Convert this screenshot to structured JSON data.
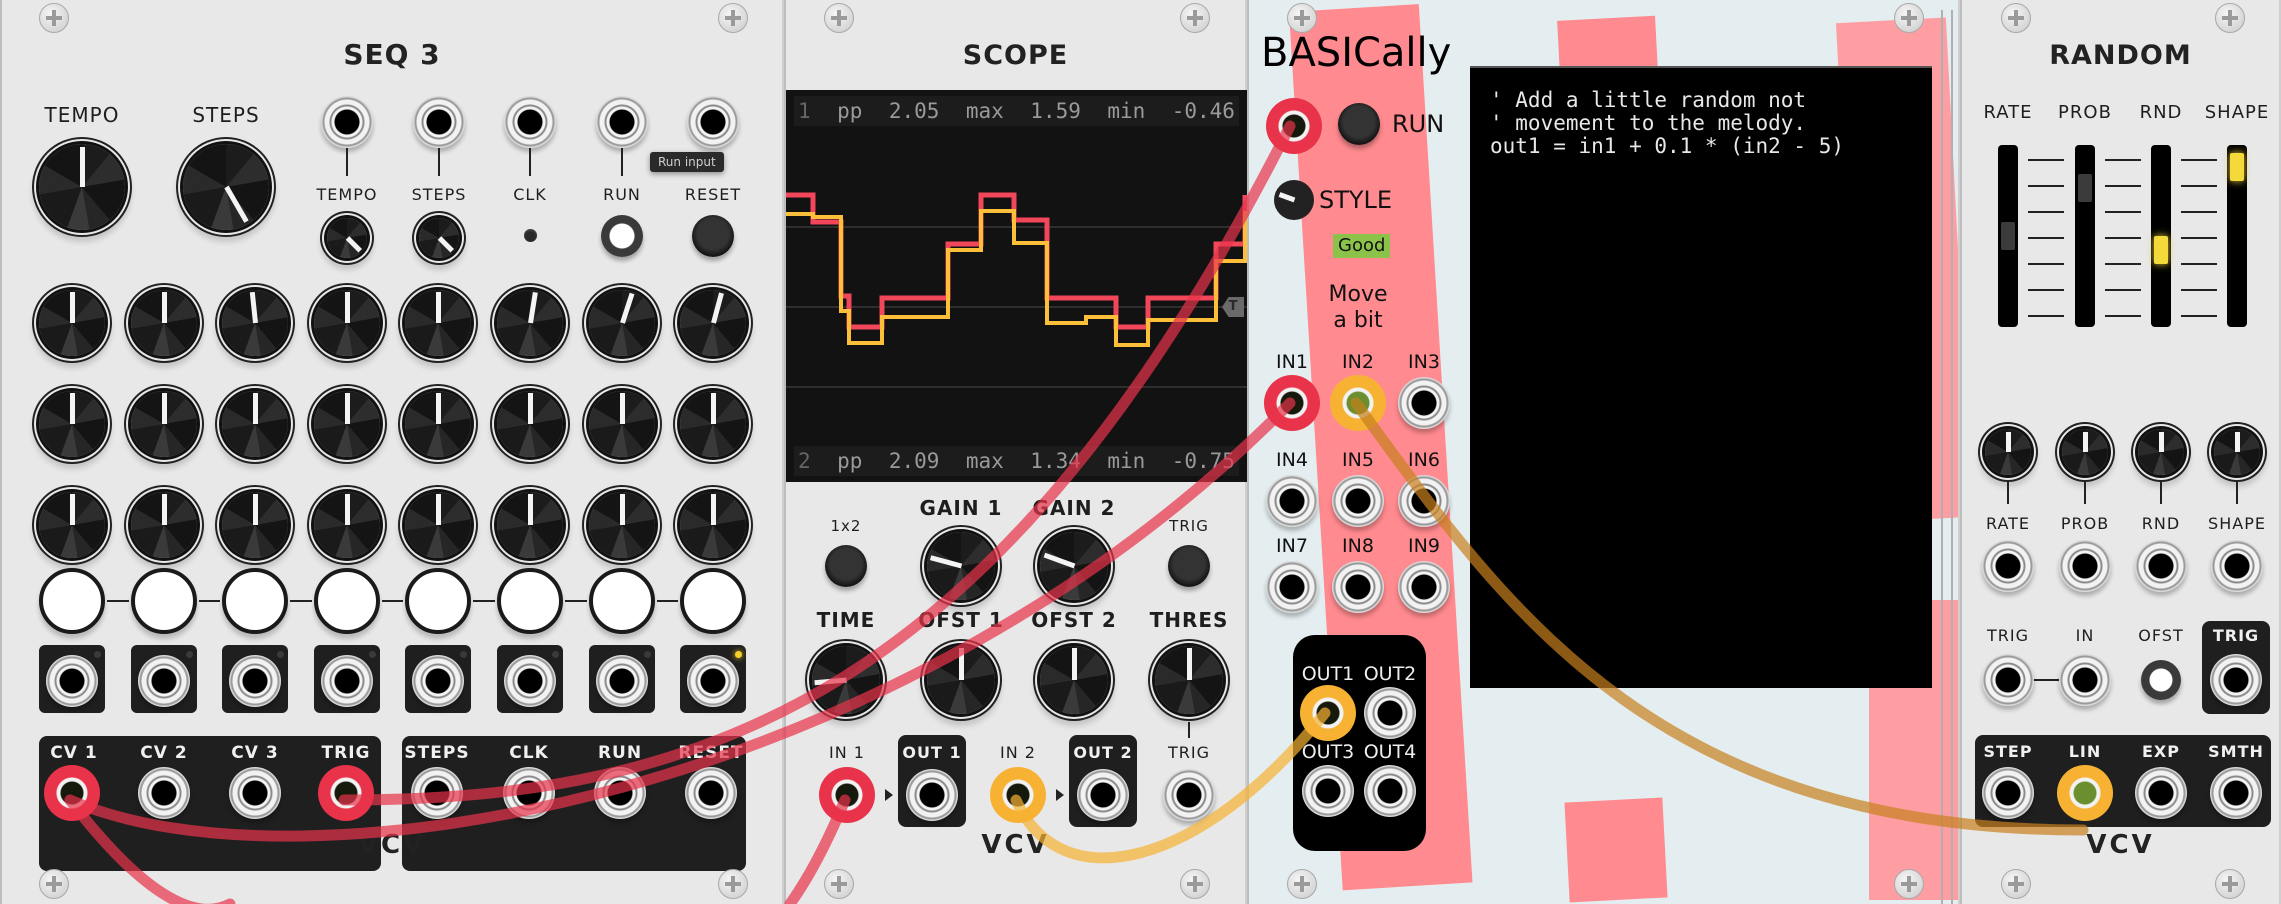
{
  "modules": {
    "seq3": {
      "title": "SEQ 3",
      "main_knobs": [
        {
          "label": "TEMPO",
          "value_fraction": 0.5
        },
        {
          "label": "STEPS",
          "value_fraction": 0.85
        }
      ],
      "cv_inputs": [
        {
          "label": "TEMPO"
        },
        {
          "label": "STEPS"
        },
        {
          "label": "CLK"
        },
        {
          "label": "RUN"
        },
        {
          "label": "RESET"
        }
      ],
      "tooltip": "Run input",
      "step_knob_rows": [
        [
          0.5,
          0.5,
          0.48,
          0.5,
          0.5,
          0.53,
          0.56,
          0.55
        ],
        [
          0.5,
          0.5,
          0.5,
          0.5,
          0.5,
          0.5,
          0.5,
          0.5
        ],
        [
          0.5,
          0.5,
          0.5,
          0.5,
          0.5,
          0.5,
          0.5,
          0.5
        ]
      ],
      "gate_buttons": 8,
      "active_step": 8,
      "outputs_left": [
        "CV 1",
        "CV 2",
        "CV 3",
        "TRIG"
      ],
      "outputs_right": [
        "STEPS",
        "CLK",
        "RUN",
        "RESET"
      ],
      "brand": "VCV"
    },
    "scope": {
      "title": "SCOPE",
      "channel1": {
        "num": "1",
        "pp_label": "pp",
        "pp": "2.05",
        "max_label": "max",
        "max": "1.59",
        "min_label": "min",
        "min": "-0.46"
      },
      "channel2": {
        "num": "2",
        "pp_label": "pp",
        "pp": "2.09",
        "max_label": "max",
        "max": "1.34",
        "min_label": "min",
        "min": "-0.75"
      },
      "trigger_marker": "T",
      "controls_row1": [
        "1x2",
        "GAIN 1",
        "GAIN 2",
        "TRIG"
      ],
      "controls_row2": [
        "TIME",
        "OFST 1",
        "OFST 2",
        "THRES"
      ],
      "io": [
        "IN 1",
        "OUT 1",
        "IN 2",
        "OUT 2",
        "TRIG"
      ],
      "brand": "VCV",
      "colors": {
        "trace1": "#f2465a",
        "trace2": "#fbbf3a"
      }
    },
    "basically": {
      "title": "BASICally",
      "run_label": "RUN",
      "style_label": "STYLE",
      "status": "Good",
      "status_color": "#8bc34a",
      "description": [
        "Move",
        "a bit"
      ],
      "inputs": [
        "IN1",
        "IN2",
        "IN3",
        "IN4",
        "IN5",
        "IN6",
        "IN7",
        "IN8",
        "IN9"
      ],
      "outputs": [
        "OUT1",
        "OUT2",
        "OUT3",
        "OUT4"
      ],
      "code_lines": [
        "' Add a little random not",
        "' movement to the melody.",
        "out1 = in1 + 0.1 * (in2 - 5)"
      ]
    },
    "random": {
      "title": "RANDOM",
      "sliders": [
        {
          "label": "RATE",
          "value_fraction": 0.5,
          "lit": false
        },
        {
          "label": "PROB",
          "value_fraction": 0.85,
          "lit": false
        },
        {
          "label": "RND",
          "value_fraction": 0.4,
          "lit": true
        },
        {
          "label": "SHAPE",
          "value_fraction": 1.0,
          "lit": true
        }
      ],
      "cv_labels": [
        "RATE",
        "PROB",
        "RND",
        "SHAPE"
      ],
      "trig_label": "TRIG",
      "in_label": "IN",
      "ofst_label": "OFST",
      "trig_out_label": "TRIG",
      "outputs": [
        "STEP",
        "LIN",
        "EXP",
        "SMTH"
      ],
      "brand": "VCV"
    }
  },
  "cable_colors": {
    "red": "#e8334a",
    "yellow": "#f7b233"
  }
}
